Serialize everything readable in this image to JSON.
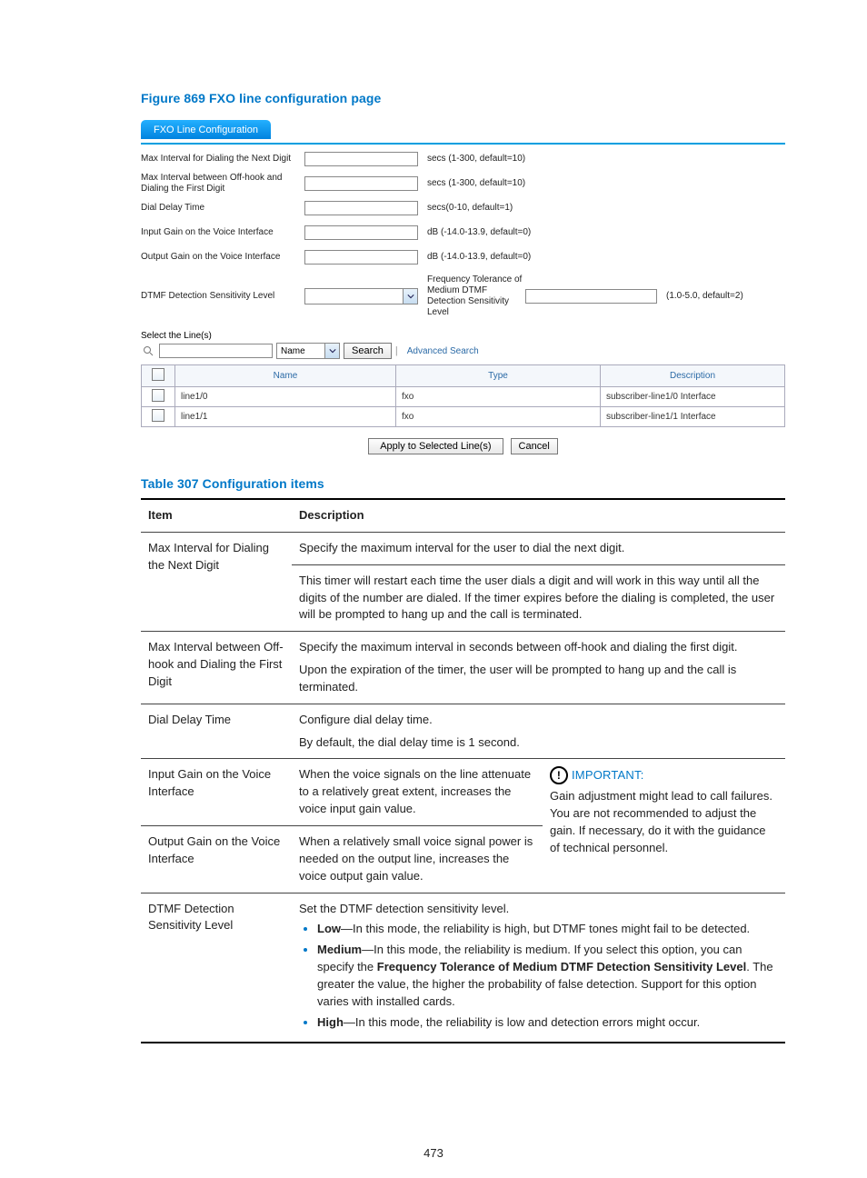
{
  "figure": {
    "title": "Figure 869 FXO line configuration page"
  },
  "tabTitle": "FXO Line Configuration",
  "form": {
    "rows": [
      {
        "label": "Max Interval for Dialing the Next Digit",
        "hint": "secs (1-300, default=10)"
      },
      {
        "label": "Max Interval between Off-hook and Dialing the First Digit",
        "hint": "secs (1-300, default=10)"
      },
      {
        "label": "Dial Delay Time",
        "hint": "secs(0-10, default=1)"
      },
      {
        "label": "Input Gain on the Voice Interface",
        "hint": "dB (-14.0-13.9, default=0)"
      },
      {
        "label": "Output Gain on the Voice Interface",
        "hint": "dB (-14.0-13.9, default=0)"
      }
    ],
    "dtmf": {
      "label": "DTMF Detection Sensitivity Level",
      "midLabel": "Frequency Tolerance of Medium DTMF Detection Sensitivity Level",
      "hint": "(1.0-5.0, default=2)"
    },
    "selectLines": "Select the Line(s)",
    "searchFieldLabel": "Name",
    "searchBtn": "Search",
    "advanced": "Advanced Search",
    "gridHeaders": [
      "",
      "Name",
      "Type",
      "Description"
    ],
    "gridRows": [
      {
        "name": "line1/0",
        "type": "fxo",
        "desc": "subscriber-line1/0 Interface"
      },
      {
        "name": "line1/1",
        "type": "fxo",
        "desc": "subscriber-line1/1 Interface"
      }
    ],
    "applyBtn": "Apply to Selected Line(s)",
    "cancelBtn": "Cancel"
  },
  "tableTitle": "Table 307 Configuration items",
  "th": {
    "item": "Item",
    "desc": "Description"
  },
  "cfg": {
    "r1item": "Max Interval for Dialing the Next Digit",
    "r1a": "Specify the maximum interval for the user to dial the next digit.",
    "r1b": "This timer will restart each time the user dials a digit and will work in this way until all the digits of the number are dialed. If the timer expires before the dialing is completed, the user will be prompted to hang up and the call is terminated.",
    "r2item": "Max Interval between Off-hook and Dialing the First Digit",
    "r2a": "Specify the maximum interval in seconds between off-hook and dialing the first digit.",
    "r2b": "Upon the expiration of the timer, the user will be prompted to hang up and the call is terminated.",
    "r3item": "Dial Delay Time",
    "r3a": "Configure dial delay time.",
    "r3b": "By default, the dial delay time is 1 second.",
    "r4item": "Input Gain on the Voice Interface",
    "r4": "When the voice signals on the line attenuate to a relatively great extent, increases the voice input gain value.",
    "r5item": "Output Gain on the Voice Interface",
    "r5": "When a relatively small voice signal power is needed on the output line, increases the voice output gain value.",
    "impTitle": "IMPORTANT:",
    "impBody": "Gain adjustment might lead to call failures. You are not recommended to adjust the gain. If necessary, do it with the guidance of technical personnel.",
    "r6item": "DTMF Detection Sensitivity Level",
    "r6a": "Set the DTMF detection sensitivity level.",
    "lowB": "Low",
    "lowT": "—In this mode, the reliability is high, but DTMF tones might fail to be detected.",
    "medB": "Medium",
    "medT1": "—In this mode, the reliability is medium. If you select this option, you can specify the ",
    "medBold": "Frequency Tolerance of Medium DTMF Detection Sensitivity Level",
    "medT2": ". The greater the value, the higher the probability of false detection. Support for this option varies with installed cards.",
    "highB": "High",
    "highT": "—In this mode, the reliability is low and detection errors might occur."
  },
  "pageNumber": "473"
}
